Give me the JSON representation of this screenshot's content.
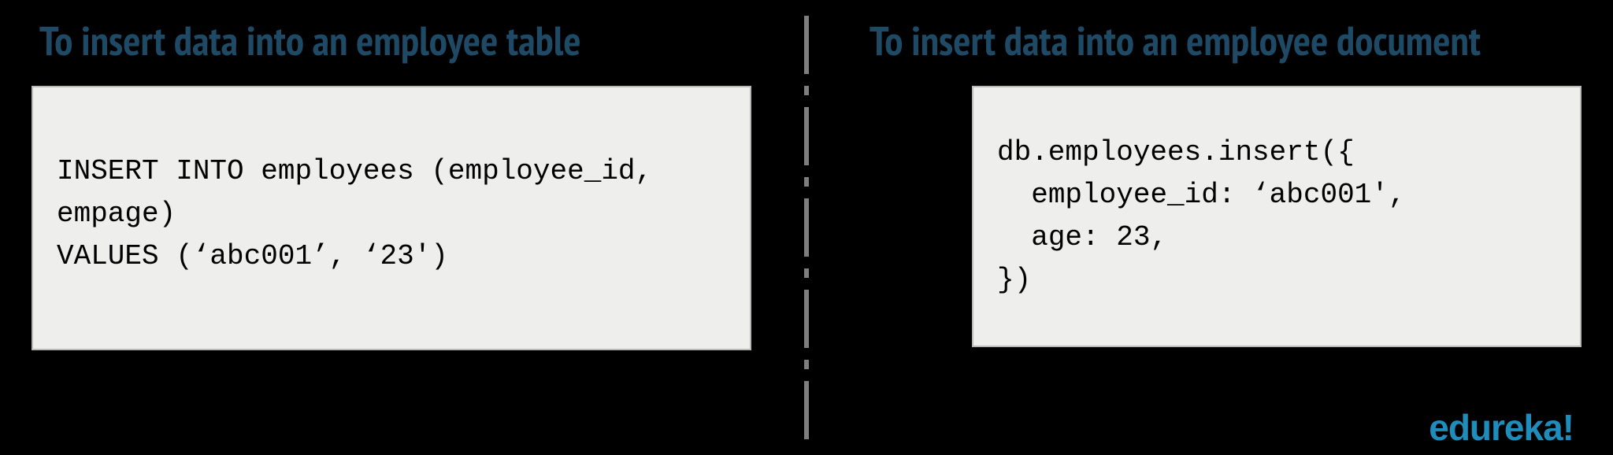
{
  "left": {
    "heading": "To insert data into an employee table",
    "code": "INSERT INTO employees (employee_id, empage)\nVALUES (‘abc001’, ‘23')"
  },
  "right": {
    "heading": "To insert data into an employee document",
    "code": "db.employees.insert({\n  employee_id: ‘abc001',\n  age: 23,\n})"
  },
  "brand": "edureka!"
}
